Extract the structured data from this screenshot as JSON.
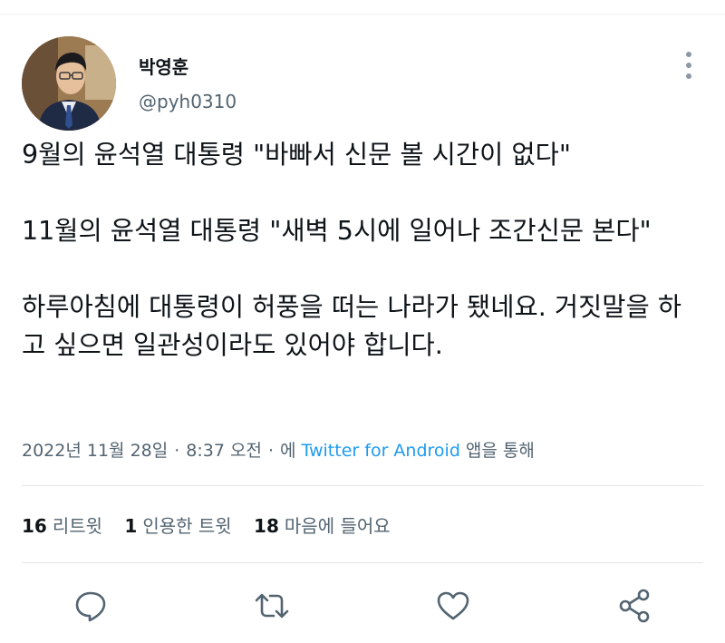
{
  "user": {
    "display_name": "박영훈",
    "handle": "@pyh0310"
  },
  "tweet": {
    "paragraphs": [
      "9월의 윤석열 대통령 \"바빠서 신문 볼 시간이 없다\"",
      "11월의 윤석열 대통령 \"새벽 5시에 일어나 조간신문 본다\"",
      "하루아침에 대통령이 허풍을 떠는 나라가 됐네요. 거짓말을 하고 싶으면 일관성이라도 있어야 합니다."
    ]
  },
  "meta": {
    "date": "2022년 11월 28일",
    "time": "8:37 오전",
    "via_prefix": "에",
    "app": "Twitter for Android",
    "via_suffix": "앱을 통해"
  },
  "stats": {
    "retweets_count": "16",
    "retweets_label": "리트윗",
    "quotes_count": "1",
    "quotes_label": "인용한 트윗",
    "likes_count": "18",
    "likes_label": "마음에 들어요"
  },
  "icons": {
    "more": "more-vertical-icon",
    "reply": "reply-icon",
    "retweet": "retweet-icon",
    "like": "heart-icon",
    "share": "share-icon"
  },
  "colors": {
    "accent": "#1d9bf0",
    "secondary_text": "#536471",
    "icon": "#536471"
  }
}
